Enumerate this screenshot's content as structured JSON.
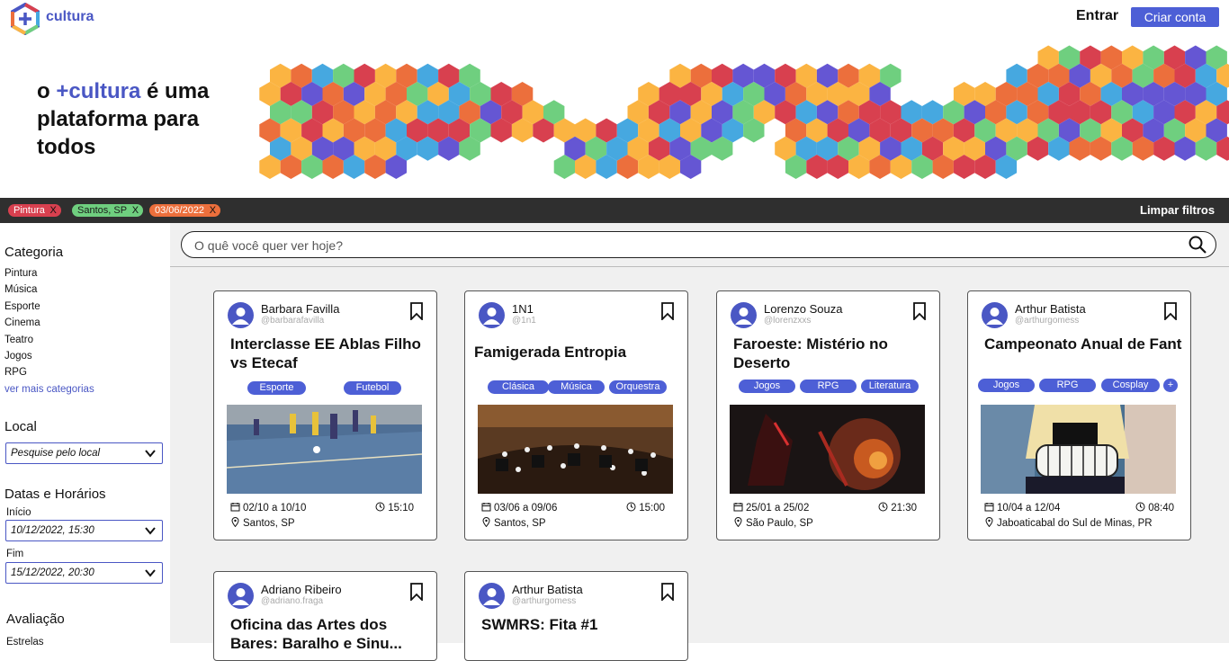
{
  "brand": {
    "name": "cultura",
    "accent": "#4a57c4"
  },
  "header": {
    "login_label": "Entrar",
    "signup_label": "Criar conta"
  },
  "hero": {
    "line1_prefix": "o ",
    "line1_accent": "+cultura",
    "line1_suffix": " é uma",
    "line2": "plataforma para",
    "line3": "todos"
  },
  "filters": {
    "chips": [
      {
        "label": "Pintura",
        "color": "#d8404f"
      },
      {
        "label": "Santos, SP",
        "color": "#6fcf7f"
      },
      {
        "label": "03/06/2022",
        "color": "#ec6f3c"
      }
    ],
    "remove_glyph": "X",
    "clear_label": "Limpar filtros"
  },
  "sidebar": {
    "category_heading": "Categoria",
    "categories": [
      "Pintura",
      "Música",
      "Esporte",
      "Cinema",
      "Teatro",
      "Jogos",
      "RPG"
    ],
    "more_label": "ver mais categorias",
    "local_heading": "Local",
    "local_placeholder": "Pesquise pelo local",
    "dates_heading": "Datas e Horários",
    "start_label": "Início",
    "start_value": "10/12/2022, 15:30",
    "end_label": "Fim",
    "end_value": "15/12/2022, 20:30",
    "rating_heading": "Avaliação",
    "stars_label": "Estrelas"
  },
  "search": {
    "placeholder": "O quê você quer ver hoje?"
  },
  "cards": [
    {
      "author": "Barbara Favilla",
      "handle": "@barbarafavilla",
      "title": "Interclasse EE Ablas Filho vs Etecaf",
      "tags": [
        "Esporte",
        "Futebol"
      ],
      "date": "02/10 a 10/10",
      "time": "15:10",
      "location": "Santos, SP",
      "image": "futsal"
    },
    {
      "author": "1N1",
      "handle": "@1n1",
      "title": "Famigerada Entropia",
      "tags": [
        "Clásica",
        "Música",
        "Orquestra"
      ],
      "date": "03/06 a 09/06",
      "time": "15:00",
      "location": "Santos, SP",
      "image": "orchestra"
    },
    {
      "author": "Lorenzo Souza",
      "handle": "@lorenzxxs",
      "title": "Faroeste: Mistério no Deserto",
      "tags": [
        "Jogos",
        "RPG",
        "Literatura"
      ],
      "date": "25/01 a 25/02",
      "time": "21:30",
      "location": "São Paulo, SP",
      "image": "fantasy"
    },
    {
      "author": "Arthur Batista",
      "handle": "@arthurgomess",
      "title": "Campeonato Anual de Fantasia de League of...",
      "tags": [
        "Jogos",
        "RPG",
        "Cosplay",
        "+"
      ],
      "date": "10/04 a 12/04",
      "time": "08:40",
      "location": "Jaboaticabal do Sul de Minas, PR",
      "image": "cosplay"
    },
    {
      "author": "Adriano Ribeiro",
      "handle": "@adriano.fraga",
      "title": "Oficina das Artes dos Bares: Baralho e Sinu...",
      "tags": [],
      "date": "",
      "time": "",
      "location": "",
      "image": ""
    },
    {
      "author": "Arthur Batista",
      "handle": "@arthurgomess",
      "title": "SWMRS: Fita #1",
      "tags": [],
      "date": "",
      "time": "",
      "location": "",
      "image": ""
    }
  ],
  "colors": {
    "primary": "#4d5fd6",
    "dark_bar": "#2f2f2f",
    "hex_palette": [
      "#d8404f",
      "#ec6f3c",
      "#fbb442",
      "#6fcf7f",
      "#46a8e0",
      "#6556d3"
    ]
  },
  "icons": [
    "logo-hexagon-icon",
    "search-icon",
    "bookmark-icon",
    "calendar-icon",
    "clock-icon",
    "location-pin-icon",
    "chevron-down-icon",
    "user-avatar-icon"
  ]
}
